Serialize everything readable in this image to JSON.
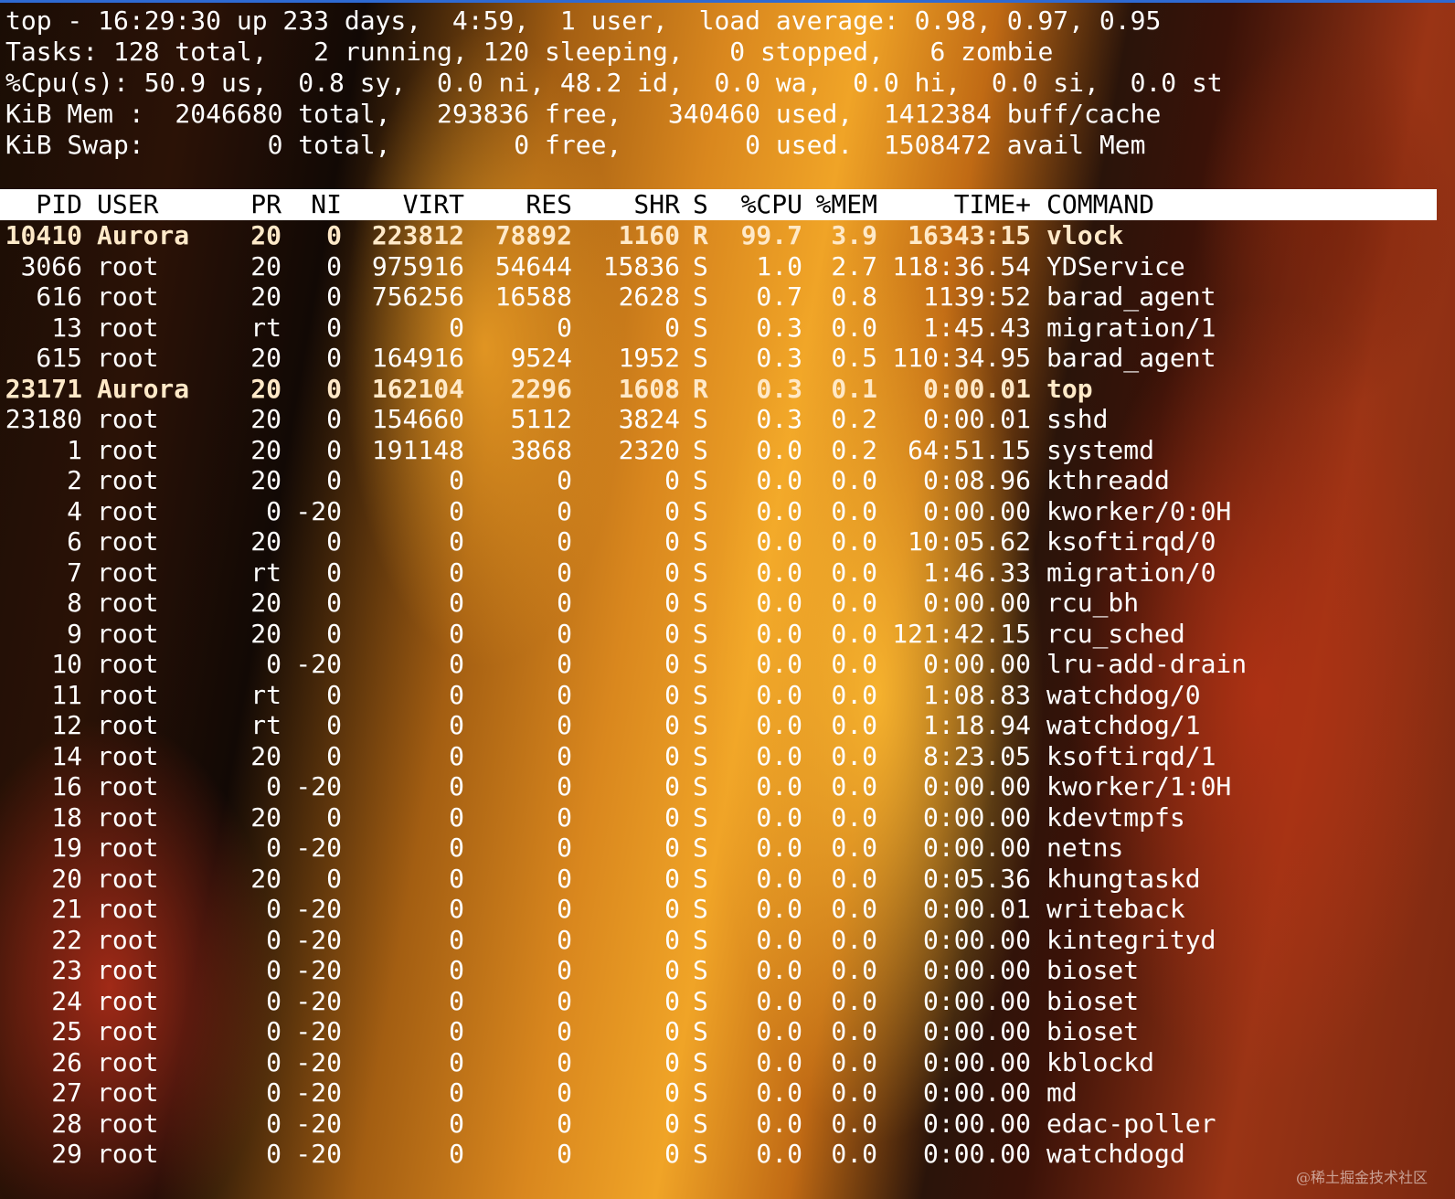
{
  "colors": {
    "header_bg": "#ffffff",
    "header_fg": "#000000",
    "text": "#ffffff",
    "title_bar_accent": "#2e6ad3"
  },
  "summary": {
    "line1": "top - 16:29:30 up 233 days,  4:59,  1 user,  load average: 0.98, 0.97, 0.95",
    "line2": "Tasks: 128 total,   2 running, 120 sleeping,   0 stopped,   6 zombie",
    "line3": "%Cpu(s): 50.9 us,  0.8 sy,  0.0 ni, 48.2 id,  0.0 wa,  0.0 hi,  0.0 si,  0.0 st",
    "line4": "KiB Mem :  2046680 total,   293836 free,   340460 used,  1412384 buff/cache",
    "line5": "KiB Swap:        0 total,        0 free,        0 used.  1508472 avail Mem"
  },
  "table": {
    "headers": {
      "pid": "PID",
      "user": "USER",
      "pr": "PR",
      "ni": "NI",
      "virt": "VIRT",
      "res": "RES",
      "shr": "SHR",
      "s": "S",
      "cpu": "%CPU",
      "mem": "%MEM",
      "time": "TIME+",
      "command": "COMMAND"
    },
    "rows": [
      {
        "pid": "10410",
        "user": "Aurora",
        "pr": "20",
        "ni": "0",
        "virt": "223812",
        "res": "78892",
        "shr": "1160",
        "s": "R",
        "cpu": "99.7",
        "mem": "3.9",
        "time": "16343:15",
        "command": "vlock",
        "running": true
      },
      {
        "pid": "3066",
        "user": "root",
        "pr": "20",
        "ni": "0",
        "virt": "975916",
        "res": "54644",
        "shr": "15836",
        "s": "S",
        "cpu": "1.0",
        "mem": "2.7",
        "time": "118:36.54",
        "command": "YDService"
      },
      {
        "pid": "616",
        "user": "root",
        "pr": "20",
        "ni": "0",
        "virt": "756256",
        "res": "16588",
        "shr": "2628",
        "s": "S",
        "cpu": "0.7",
        "mem": "0.8",
        "time": "1139:52",
        "command": "barad_agent"
      },
      {
        "pid": "13",
        "user": "root",
        "pr": "rt",
        "ni": "0",
        "virt": "0",
        "res": "0",
        "shr": "0",
        "s": "S",
        "cpu": "0.3",
        "mem": "0.0",
        "time": "1:45.43",
        "command": "migration/1"
      },
      {
        "pid": "615",
        "user": "root",
        "pr": "20",
        "ni": "0",
        "virt": "164916",
        "res": "9524",
        "shr": "1952",
        "s": "S",
        "cpu": "0.3",
        "mem": "0.5",
        "time": "110:34.95",
        "command": "barad_agent"
      },
      {
        "pid": "23171",
        "user": "Aurora",
        "pr": "20",
        "ni": "0",
        "virt": "162104",
        "res": "2296",
        "shr": "1608",
        "s": "R",
        "cpu": "0.3",
        "mem": "0.1",
        "time": "0:00.01",
        "command": "top",
        "running": true
      },
      {
        "pid": "23180",
        "user": "root",
        "pr": "20",
        "ni": "0",
        "virt": "154660",
        "res": "5112",
        "shr": "3824",
        "s": "S",
        "cpu": "0.3",
        "mem": "0.2",
        "time": "0:00.01",
        "command": "sshd"
      },
      {
        "pid": "1",
        "user": "root",
        "pr": "20",
        "ni": "0",
        "virt": "191148",
        "res": "3868",
        "shr": "2320",
        "s": "S",
        "cpu": "0.0",
        "mem": "0.2",
        "time": "64:51.15",
        "command": "systemd"
      },
      {
        "pid": "2",
        "user": "root",
        "pr": "20",
        "ni": "0",
        "virt": "0",
        "res": "0",
        "shr": "0",
        "s": "S",
        "cpu": "0.0",
        "mem": "0.0",
        "time": "0:08.96",
        "command": "kthreadd"
      },
      {
        "pid": "4",
        "user": "root",
        "pr": "0",
        "ni": "-20",
        "virt": "0",
        "res": "0",
        "shr": "0",
        "s": "S",
        "cpu": "0.0",
        "mem": "0.0",
        "time": "0:00.00",
        "command": "kworker/0:0H"
      },
      {
        "pid": "6",
        "user": "root",
        "pr": "20",
        "ni": "0",
        "virt": "0",
        "res": "0",
        "shr": "0",
        "s": "S",
        "cpu": "0.0",
        "mem": "0.0",
        "time": "10:05.62",
        "command": "ksoftirqd/0"
      },
      {
        "pid": "7",
        "user": "root",
        "pr": "rt",
        "ni": "0",
        "virt": "0",
        "res": "0",
        "shr": "0",
        "s": "S",
        "cpu": "0.0",
        "mem": "0.0",
        "time": "1:46.33",
        "command": "migration/0"
      },
      {
        "pid": "8",
        "user": "root",
        "pr": "20",
        "ni": "0",
        "virt": "0",
        "res": "0",
        "shr": "0",
        "s": "S",
        "cpu": "0.0",
        "mem": "0.0",
        "time": "0:00.00",
        "command": "rcu_bh"
      },
      {
        "pid": "9",
        "user": "root",
        "pr": "20",
        "ni": "0",
        "virt": "0",
        "res": "0",
        "shr": "0",
        "s": "S",
        "cpu": "0.0",
        "mem": "0.0",
        "time": "121:42.15",
        "command": "rcu_sched"
      },
      {
        "pid": "10",
        "user": "root",
        "pr": "0",
        "ni": "-20",
        "virt": "0",
        "res": "0",
        "shr": "0",
        "s": "S",
        "cpu": "0.0",
        "mem": "0.0",
        "time": "0:00.00",
        "command": "lru-add-drain"
      },
      {
        "pid": "11",
        "user": "root",
        "pr": "rt",
        "ni": "0",
        "virt": "0",
        "res": "0",
        "shr": "0",
        "s": "S",
        "cpu": "0.0",
        "mem": "0.0",
        "time": "1:08.83",
        "command": "watchdog/0"
      },
      {
        "pid": "12",
        "user": "root",
        "pr": "rt",
        "ni": "0",
        "virt": "0",
        "res": "0",
        "shr": "0",
        "s": "S",
        "cpu": "0.0",
        "mem": "0.0",
        "time": "1:18.94",
        "command": "watchdog/1"
      },
      {
        "pid": "14",
        "user": "root",
        "pr": "20",
        "ni": "0",
        "virt": "0",
        "res": "0",
        "shr": "0",
        "s": "S",
        "cpu": "0.0",
        "mem": "0.0",
        "time": "8:23.05",
        "command": "ksoftirqd/1"
      },
      {
        "pid": "16",
        "user": "root",
        "pr": "0",
        "ni": "-20",
        "virt": "0",
        "res": "0",
        "shr": "0",
        "s": "S",
        "cpu": "0.0",
        "mem": "0.0",
        "time": "0:00.00",
        "command": "kworker/1:0H"
      },
      {
        "pid": "18",
        "user": "root",
        "pr": "20",
        "ni": "0",
        "virt": "0",
        "res": "0",
        "shr": "0",
        "s": "S",
        "cpu": "0.0",
        "mem": "0.0",
        "time": "0:00.00",
        "command": "kdevtmpfs"
      },
      {
        "pid": "19",
        "user": "root",
        "pr": "0",
        "ni": "-20",
        "virt": "0",
        "res": "0",
        "shr": "0",
        "s": "S",
        "cpu": "0.0",
        "mem": "0.0",
        "time": "0:00.00",
        "command": "netns"
      },
      {
        "pid": "20",
        "user": "root",
        "pr": "20",
        "ni": "0",
        "virt": "0",
        "res": "0",
        "shr": "0",
        "s": "S",
        "cpu": "0.0",
        "mem": "0.0",
        "time": "0:05.36",
        "command": "khungtaskd"
      },
      {
        "pid": "21",
        "user": "root",
        "pr": "0",
        "ni": "-20",
        "virt": "0",
        "res": "0",
        "shr": "0",
        "s": "S",
        "cpu": "0.0",
        "mem": "0.0",
        "time": "0:00.01",
        "command": "writeback"
      },
      {
        "pid": "22",
        "user": "root",
        "pr": "0",
        "ni": "-20",
        "virt": "0",
        "res": "0",
        "shr": "0",
        "s": "S",
        "cpu": "0.0",
        "mem": "0.0",
        "time": "0:00.00",
        "command": "kintegrityd"
      },
      {
        "pid": "23",
        "user": "root",
        "pr": "0",
        "ni": "-20",
        "virt": "0",
        "res": "0",
        "shr": "0",
        "s": "S",
        "cpu": "0.0",
        "mem": "0.0",
        "time": "0:00.00",
        "command": "bioset"
      },
      {
        "pid": "24",
        "user": "root",
        "pr": "0",
        "ni": "-20",
        "virt": "0",
        "res": "0",
        "shr": "0",
        "s": "S",
        "cpu": "0.0",
        "mem": "0.0",
        "time": "0:00.00",
        "command": "bioset"
      },
      {
        "pid": "25",
        "user": "root",
        "pr": "0",
        "ni": "-20",
        "virt": "0",
        "res": "0",
        "shr": "0",
        "s": "S",
        "cpu": "0.0",
        "mem": "0.0",
        "time": "0:00.00",
        "command": "bioset"
      },
      {
        "pid": "26",
        "user": "root",
        "pr": "0",
        "ni": "-20",
        "virt": "0",
        "res": "0",
        "shr": "0",
        "s": "S",
        "cpu": "0.0",
        "mem": "0.0",
        "time": "0:00.00",
        "command": "kblockd"
      },
      {
        "pid": "27",
        "user": "root",
        "pr": "0",
        "ni": "-20",
        "virt": "0",
        "res": "0",
        "shr": "0",
        "s": "S",
        "cpu": "0.0",
        "mem": "0.0",
        "time": "0:00.00",
        "command": "md"
      },
      {
        "pid": "28",
        "user": "root",
        "pr": "0",
        "ni": "-20",
        "virt": "0",
        "res": "0",
        "shr": "0",
        "s": "S",
        "cpu": "0.0",
        "mem": "0.0",
        "time": "0:00.00",
        "command": "edac-poller"
      },
      {
        "pid": "29",
        "user": "root",
        "pr": "0",
        "ni": "-20",
        "virt": "0",
        "res": "0",
        "shr": "0",
        "s": "S",
        "cpu": "0.0",
        "mem": "0.0",
        "time": "0:00.00",
        "command": "watchdogd"
      }
    ]
  },
  "watermark": "@稀土掘金技术社区"
}
